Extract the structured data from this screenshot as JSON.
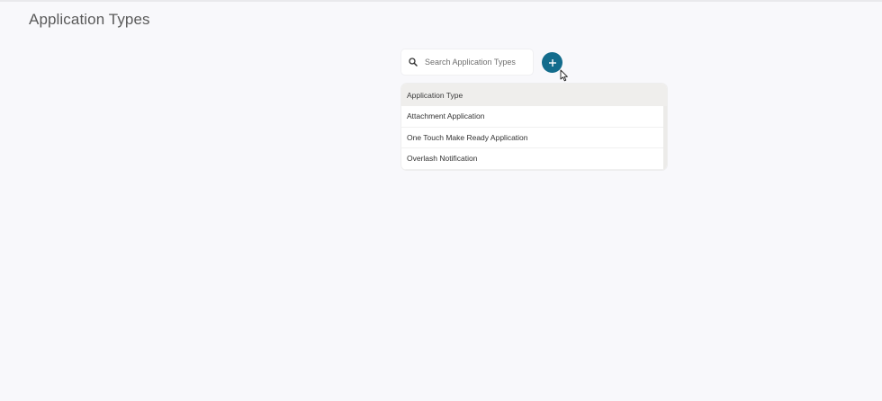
{
  "page": {
    "title": "Application Types"
  },
  "search": {
    "placeholder": "Search Application Types",
    "value": "",
    "icon": "search-icon"
  },
  "add_button": {
    "icon": "plus-icon",
    "color": "#136c8c"
  },
  "table": {
    "header": "Application Type",
    "rows": [
      "Attachment Application",
      "One Touch Make Ready Application",
      "Overlash Notification"
    ]
  }
}
